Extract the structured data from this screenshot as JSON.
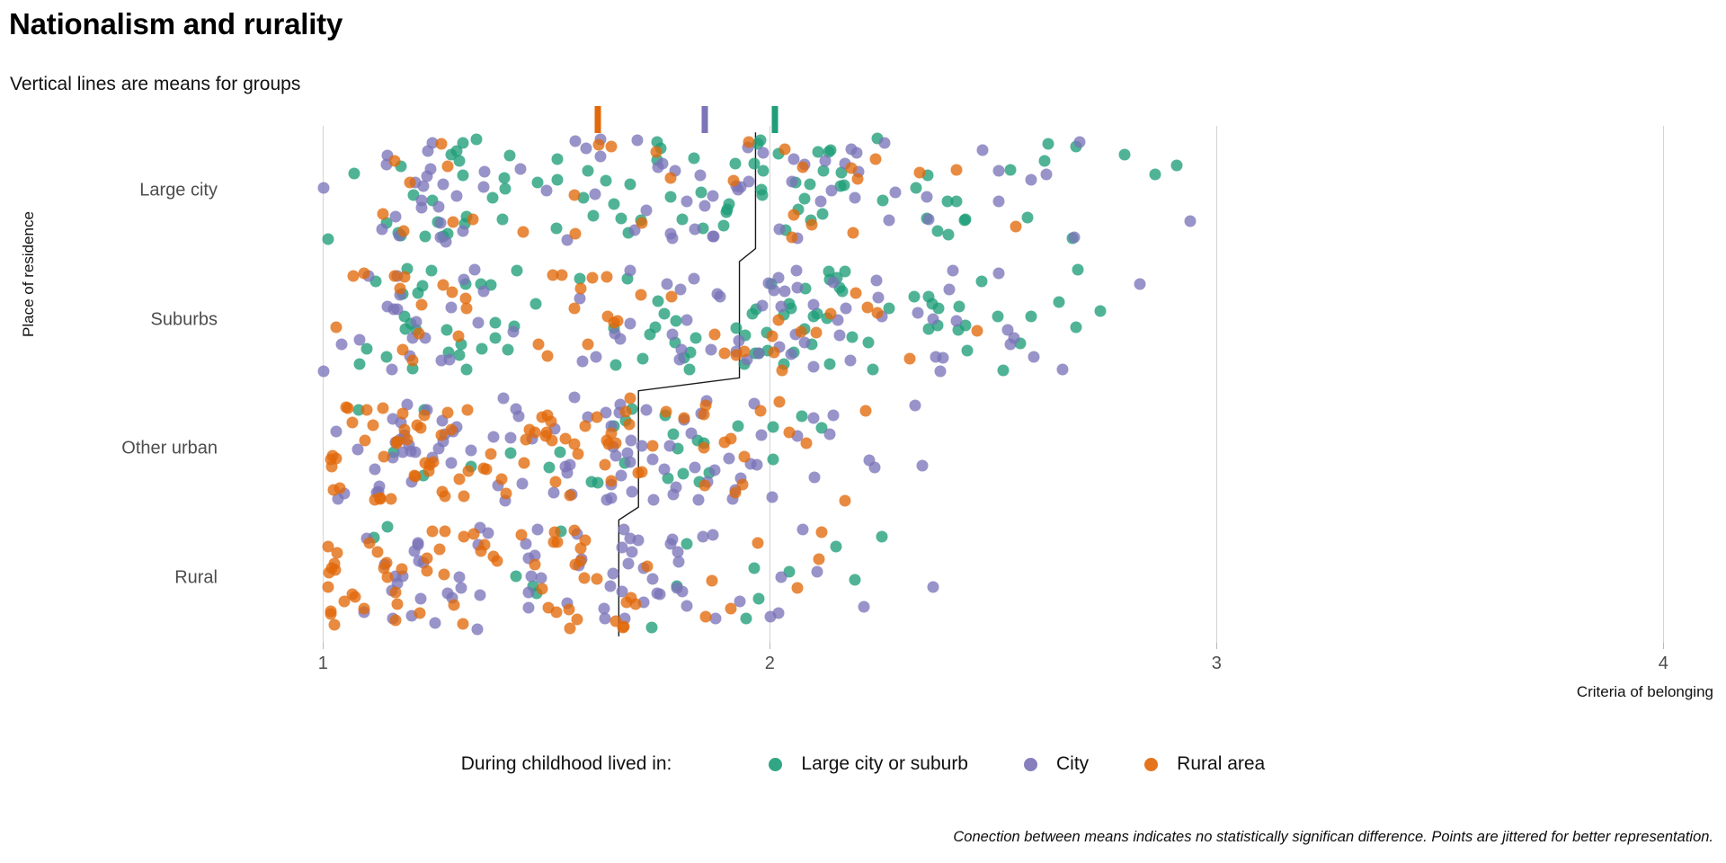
{
  "header": {
    "title": "Nationalism and rurality",
    "subtitle": "Vertical lines are means for groups"
  },
  "caption": "Conection between means indicates no statistically significan difference. Points are jittered for better representation.",
  "legend": {
    "title": "During childhood lived in:",
    "items": [
      {
        "label": "Large city or suburb",
        "color": "#1f9e79"
      },
      {
        "label": "City",
        "color": "#7b74b8"
      },
      {
        "label": "Rural area",
        "color": "#e2690a"
      }
    ]
  },
  "chart_data": {
    "type": "scatter",
    "title": "Nationalism and rurality",
    "subtitle": "Vertical lines are means for groups",
    "xlabel": "Criteria of belonging",
    "ylabel": "Place of residence",
    "xlim": [
      0.78,
      4.12
    ],
    "xticks": [
      1,
      2,
      3,
      4
    ],
    "xtick_labels": [
      "1",
      "2",
      "3",
      "4"
    ],
    "grid": "vertical-major-only",
    "legend_position": "bottom-center",
    "y_categories": [
      "Large city",
      "Suburbs",
      "Other urban",
      "Rural"
    ],
    "series": [
      {
        "name": "Large city or suburb",
        "color": "#1f9e79"
      },
      {
        "name": "City",
        "color": "#7b74b8"
      },
      {
        "name": "Rural area",
        "color": "#e2690a"
      }
    ],
    "overall_means": [
      {
        "group": "Rural area",
        "color": "#e2690a",
        "value": 1.615
      },
      {
        "group": "City",
        "color": "#7b74b8",
        "value": 1.855
      },
      {
        "group": "Large city or suburb",
        "color": "#1f9e79",
        "value": 2.012
      }
    ],
    "group_means": [
      {
        "category": "Large city",
        "mean": 1.965
      },
      {
        "category": "Suburbs",
        "mean": 1.945
      },
      {
        "category": "Other urban",
        "mean": 1.705
      },
      {
        "category": "Rural",
        "mean": 1.665
      }
    ],
    "connection_path": [
      {
        "category": "Large city",
        "x": 1.968
      },
      {
        "category": "Suburbs",
        "x": 1.932
      },
      {
        "category": "Other urban",
        "x": 1.706
      },
      {
        "category": "Rural",
        "x": 1.662
      }
    ],
    "point_counts": {
      "Large city": {
        "Large city or suburb": 92,
        "City": 78,
        "Rural area": 30
      },
      "Suburbs": {
        "Large city or suburb": 95,
        "City": 80,
        "Rural area": 45
      },
      "Other urban": {
        "Large city or suburb": 28,
        "City": 95,
        "Rural area": 92
      },
      "Rural": {
        "Large city or suburb": 16,
        "City": 72,
        "Rural area": 70
      }
    },
    "notes": "Jittered strip/dot plot; point positions are jittered within each category band for better representation."
  }
}
